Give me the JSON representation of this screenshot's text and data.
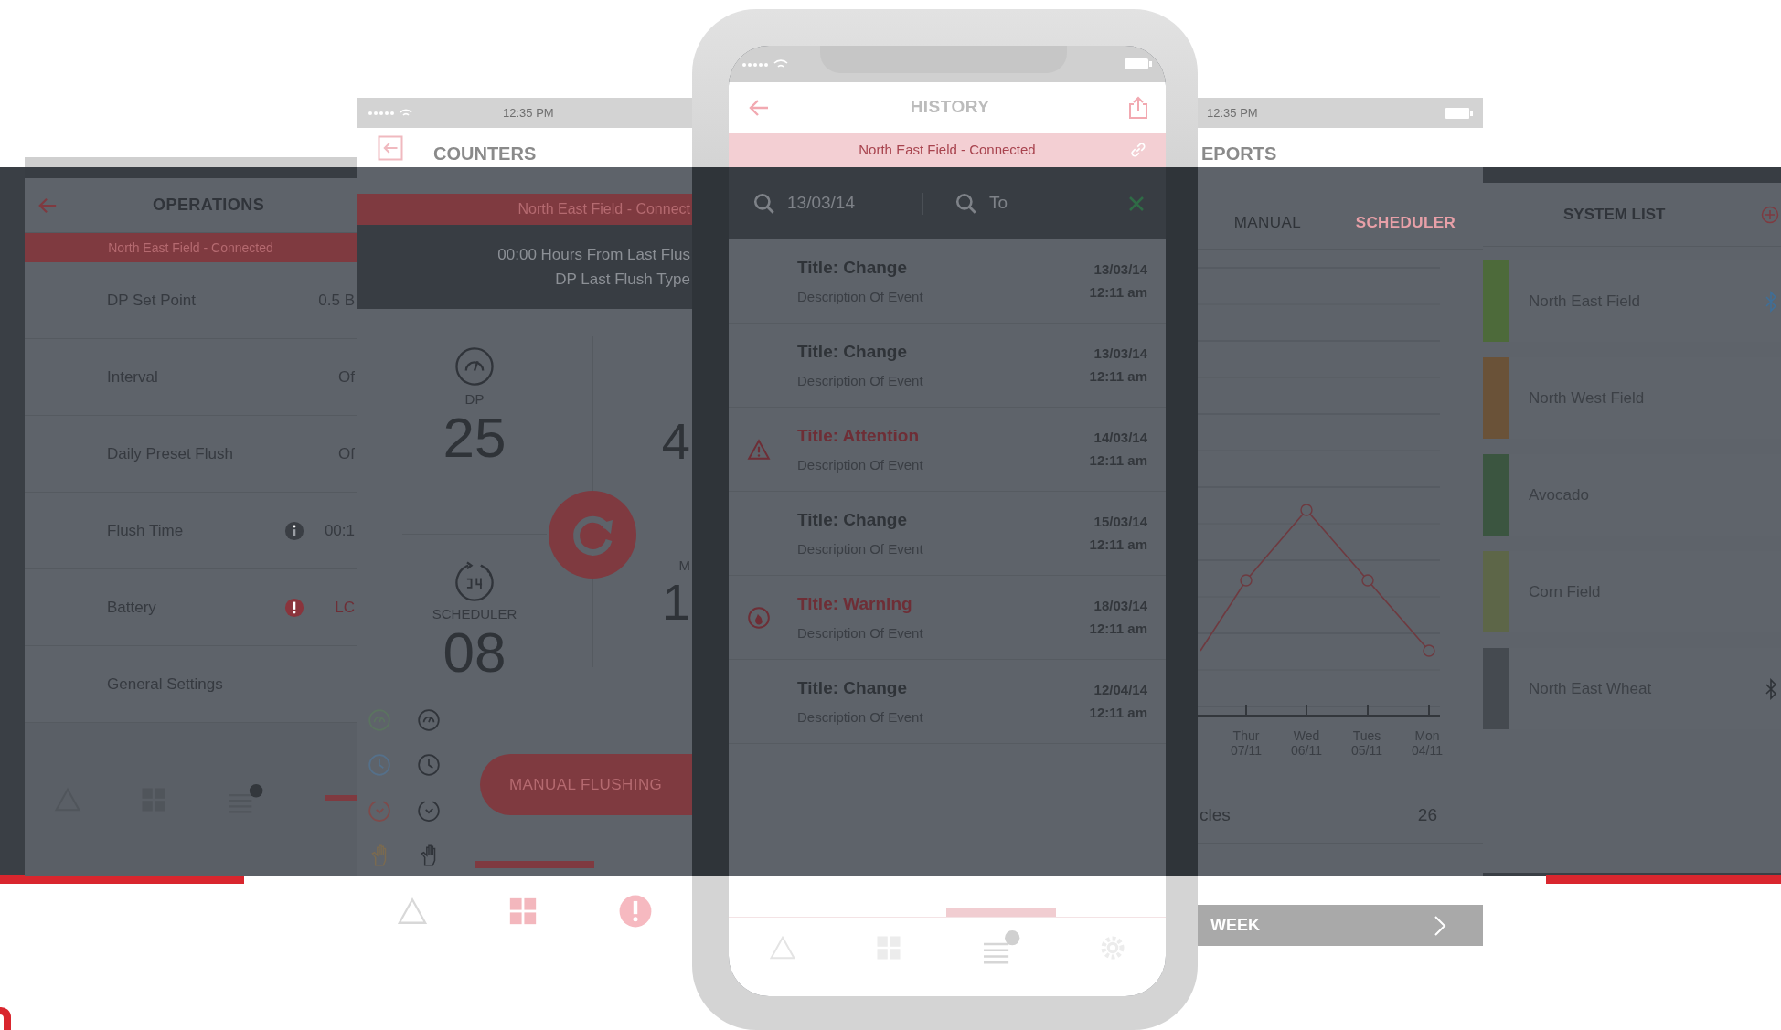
{
  "operations_screen": {
    "title": "OPERATIONS",
    "banner": "North East Field - Connected",
    "rows": [
      {
        "kind": "plain",
        "label": "DP Set Point",
        "value": "0.5 B"
      },
      {
        "kind": "plain",
        "label": "Interval",
        "value": "Of"
      },
      {
        "kind": "plain",
        "label": "Daily Preset Flush",
        "value": "Of"
      },
      {
        "kind": "info",
        "label": "Flush Time",
        "value": "00:1"
      },
      {
        "kind": "alert",
        "label": "Battery",
        "value": "LC"
      },
      {
        "kind": "plain",
        "label": "General Settings"
      }
    ]
  },
  "counters_screen": {
    "status_time": "12:35 PM",
    "title": "COUNTERS",
    "banner": "North East Field - Connect",
    "info_lines": [
      "00:00 Hours From Last Flus",
      "DP Last Flush Type"
    ],
    "counters": [
      {
        "kind": "dp",
        "label": "DP",
        "value": "25"
      },
      {
        "kind": "scheduler",
        "label": "SCHEDULER",
        "value": "08"
      }
    ],
    "cut_counters": [
      {
        "value": "4"
      },
      {
        "label": "M",
        "value": "1"
      }
    ],
    "button": "MANUAL FLUSHING"
  },
  "history_screen": {
    "title": "HISTORY",
    "banner": "North East Field - Connected",
    "search_from": {
      "value": "13/03/14"
    },
    "search_to": {
      "placeholder": "To"
    },
    "events": [
      {
        "kind": "change",
        "title": "Title: Change",
        "description": "Description Of Event",
        "date": "13/03/14",
        "time": "12:11 am"
      },
      {
        "kind": "change",
        "title": "Title: Change",
        "description": "Description Of Event",
        "date": "13/03/14",
        "time": "12:11 am"
      },
      {
        "kind": "attention",
        "title": "Title: Attention",
        "description": "Description Of Event",
        "date": "14/03/14",
        "time": "12:11 am"
      },
      {
        "kind": "change",
        "title": "Title: Change",
        "description": "Description Of Event",
        "date": "15/03/14",
        "time": "12:11 am"
      },
      {
        "kind": "warning",
        "title": "Title: Warning",
        "description": "Description Of Event",
        "date": "18/03/14",
        "time": "12:11 am"
      },
      {
        "kind": "change",
        "title": "Title: Change",
        "description": "Description Of Event",
        "date": "12/04/14",
        "time": "12:11 am"
      }
    ]
  },
  "reports_screen": {
    "status_time": "12:35 PM",
    "title": "EPORTS",
    "tabs": [
      {
        "label": "MANUAL",
        "selected": false
      },
      {
        "label": "SCHEDULER",
        "selected": true
      }
    ],
    "x_labels": [
      {
        "day": "Thur",
        "date": "07/11"
      },
      {
        "day": "Wed",
        "date": "06/11"
      },
      {
        "day": "Tues",
        "date": "05/11"
      },
      {
        "day": "Mon",
        "date": "04/11"
      }
    ],
    "summary": {
      "label": "cles",
      "value": "26"
    },
    "footer_button": "WEEK"
  },
  "system_list_screen": {
    "title": "SYSTEM LIST",
    "items": [
      {
        "name": "North East Field",
        "bluetooth": true,
        "color": "#4d6a3a"
      },
      {
        "name": "North West Field",
        "bluetooth": false,
        "color": "#6a5238"
      },
      {
        "name": "Avocado",
        "bluetooth": false,
        "color": "#3b5540"
      },
      {
        "name": "Corn Field",
        "bluetooth": false,
        "color": "#5d6648"
      },
      {
        "name": "North East Wheat",
        "bluetooth": true,
        "color": "#454a50"
      }
    ]
  }
}
